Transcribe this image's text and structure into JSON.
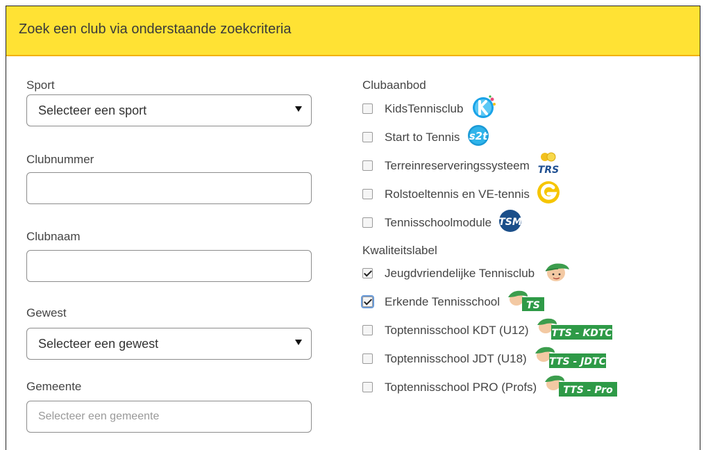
{
  "header": {
    "title": "Zoek een club via onderstaande zoekcriteria"
  },
  "left": {
    "sport": {
      "label": "Sport",
      "value": "Selecteer een sport"
    },
    "clubnummer": {
      "label": "Clubnummer",
      "value": ""
    },
    "clubnaam": {
      "label": "Clubnaam",
      "value": ""
    },
    "gewest": {
      "label": "Gewest",
      "value": "Selecteer een gewest"
    },
    "gemeente": {
      "label": "Gemeente",
      "placeholder": "Selecteer een gemeente"
    }
  },
  "clubaanbod": {
    "title": "Clubaanbod",
    "items": [
      {
        "label": "KidsTennisclub",
        "checked": false,
        "icon": "kids-tennisclub-icon"
      },
      {
        "label": "Start to Tennis",
        "checked": false,
        "icon": "start-to-tennis-icon"
      },
      {
        "label": "Terreinreserveringssysteem",
        "checked": false,
        "icon": "trs-icon"
      },
      {
        "label": "Rolstoeltennis en VE-tennis",
        "checked": false,
        "icon": "rolstoeltennis-icon"
      },
      {
        "label": "Tennisschoolmodule",
        "checked": false,
        "icon": "tsm-icon"
      }
    ]
  },
  "kwaliteitslabel": {
    "title": "Kwaliteitslabel",
    "items": [
      {
        "label": "Jeugdvriendelijke Tennisclub",
        "checked": true,
        "icon": "jeugdvriendelijk-icon"
      },
      {
        "label": "Erkende Tennisschool",
        "checked": true,
        "icon": "ts-icon",
        "badge": "TS"
      },
      {
        "label": "Toptennisschool KDT (U12)",
        "checked": false,
        "icon": "tts-kdtc-icon",
        "badge": "TTS - KDTC"
      },
      {
        "label": "Toptennisschool JDT (U18)",
        "checked": false,
        "icon": "tts-jdtc-icon",
        "badge": "TTS - JDTC"
      },
      {
        "label": "Toptennisschool PRO (Profs)",
        "checked": false,
        "icon": "tts-pro-icon",
        "badge": "TTS - Pro"
      }
    ]
  },
  "colors": {
    "header_bg": "#ffe234",
    "header_border": "#f2b100",
    "badge_green": "#2e9a47"
  }
}
